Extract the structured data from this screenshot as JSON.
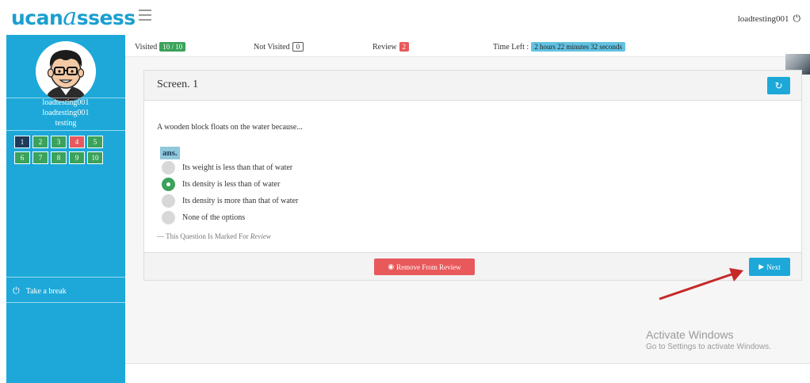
{
  "header": {
    "logo_main": "ucan",
    "logo_a": "a",
    "logo_rest": "ssess",
    "username": "loadtesting001",
    "power_icon": "⏻"
  },
  "sidebar": {
    "name1": "loadtesting001",
    "name2": "loadtesting001",
    "name3": "testing",
    "questions": [
      {
        "label": "1",
        "state": "current"
      },
      {
        "label": "2",
        "state": "visited"
      },
      {
        "label": "3",
        "state": "visited"
      },
      {
        "label": "4",
        "state": "review"
      },
      {
        "label": "5",
        "state": "visited"
      },
      {
        "label": "6",
        "state": "visited"
      },
      {
        "label": "7",
        "state": "visited"
      },
      {
        "label": "8",
        "state": "visited"
      },
      {
        "label": "9",
        "state": "visited"
      },
      {
        "label": "10",
        "state": "visited"
      }
    ],
    "break_label": "Take a break"
  },
  "status": {
    "visited_label": "Visited",
    "visited_value": "10 / 10",
    "not_visited_label": "Not Visited",
    "not_visited_value": "0",
    "review_label": "Review",
    "review_value": "2",
    "time_label": "Time Left :",
    "time_value": "2 hours 22 minutes 32 seconds"
  },
  "panel": {
    "title": "Screen. 1",
    "refresh_icon": "↻",
    "question": "A wooden block floats on the water because...",
    "ans_label": "ans.",
    "options": [
      {
        "text": "Its weight is less than that of water",
        "selected": false
      },
      {
        "text": "Its density is less than of water",
        "selected": true
      },
      {
        "text": "Its density is more than that of water",
        "selected": false
      },
      {
        "text": "None of the options",
        "selected": false
      }
    ],
    "marked_prefix": "— This Question Is Marked For",
    "marked_word": "Review",
    "remove_icon": "◉",
    "remove_label": "Remove From Review",
    "next_icon": "▶",
    "next_label": "Next"
  },
  "watermark": {
    "line1": "Activate Windows",
    "line2": "Go to Settings to activate Windows."
  },
  "colors": {
    "brand_blue": "#1da8d9",
    "visited_green": "#3aa25a",
    "review_red": "#e8595b",
    "current_navy": "#1f3b5b"
  }
}
